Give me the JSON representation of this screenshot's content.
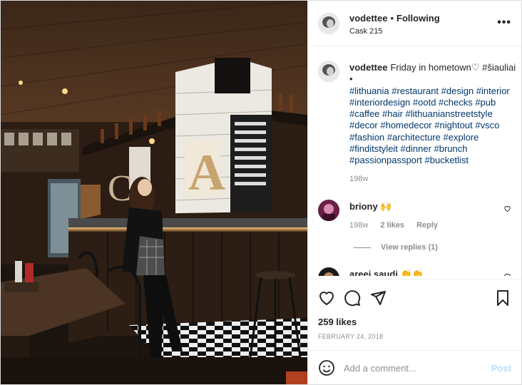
{
  "post": {
    "username": "vodettee",
    "separator": "•",
    "follow_state": "Following",
    "location": "Cask 215",
    "more_icon": "more-horizontal-icon"
  },
  "caption": {
    "username": "vodettee",
    "text": "Friday in hometown♡ #šiauliai",
    "bullet": "•",
    "hashtags": "#lithuania #restaurant #design #interior #interiordesign #ootd #checks #pub #caffee #hair #lithuanianstreetstyle #decor #homedecor #nightout #vsco #fashion #architecture #explore #finditstyleit #dinner #brunch #passionpassport #bucketlist",
    "time": "198w"
  },
  "comments": [
    {
      "username": "briony",
      "text": "🙌",
      "time": "198w",
      "likes": "2 likes",
      "reply_label": "Reply",
      "view_replies": "View replies (1)"
    },
    {
      "username": "areei.saudi",
      "text": "👏👏"
    }
  ],
  "actions": {
    "like_icon": "heart-icon",
    "comment_icon": "comment-icon",
    "share_icon": "paper-plane-icon",
    "save_icon": "bookmark-icon"
  },
  "likes_count": "259 likes",
  "date": "FEBRUARY 24, 2018",
  "add_comment": {
    "placeholder": "Add a comment...",
    "post_label": "Post",
    "emoji_icon": "emoji-icon"
  },
  "colors": {
    "link": "#00376b",
    "muted": "#8e8e8e",
    "post_disabled": "#b2dffc"
  }
}
